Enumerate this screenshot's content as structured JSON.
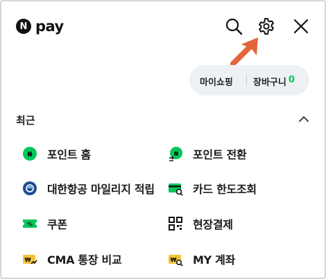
{
  "header": {
    "logo_badge": "N",
    "logo_text": "pay"
  },
  "quick_links": {
    "my_shopping": "마이쇼핑",
    "cart_label": "장바구니",
    "cart_count": "0"
  },
  "section": {
    "title": "최근"
  },
  "menu": {
    "items": [
      {
        "label": "포인트 홈",
        "icon": "naver-point-icon"
      },
      {
        "label": "포인트 전환",
        "icon": "point-exchange-icon"
      },
      {
        "label": "대한항공 마일리지 적립",
        "icon": "korean-air-icon"
      },
      {
        "label": "카드 한도조회",
        "icon": "card-search-icon"
      },
      {
        "label": "쿠폰",
        "icon": "coupon-icon"
      },
      {
        "label": "현장결제",
        "icon": "qr-code-icon"
      },
      {
        "label": "CMA 통장 비교",
        "icon": "cma-compare-icon"
      },
      {
        "label": "MY 계좌",
        "icon": "my-account-icon"
      }
    ]
  },
  "colors": {
    "brand_green": "#03c75a",
    "arrow_orange": "#e2663b",
    "korean_air_blue": "#1f4d8f",
    "gold": "#f1c23a"
  }
}
